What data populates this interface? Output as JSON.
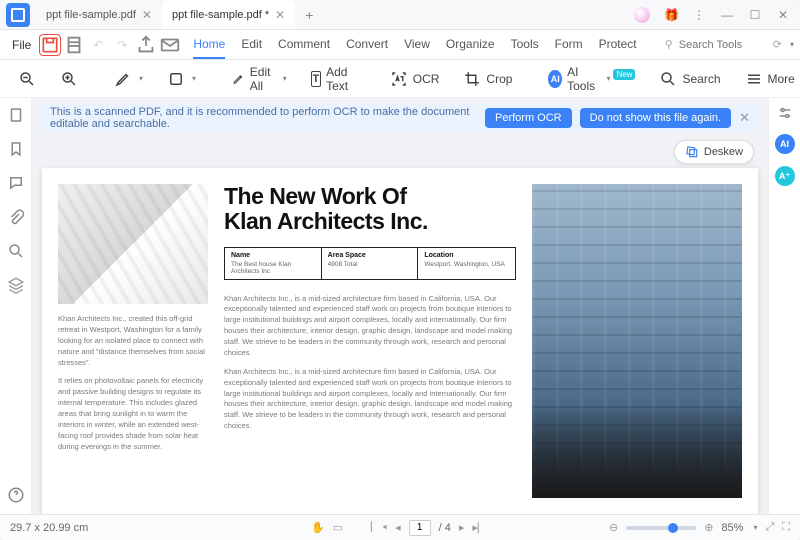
{
  "tabs": [
    {
      "label": "ppt file-sample.pdf"
    },
    {
      "label": "ppt file-sample.pdf *"
    }
  ],
  "menu": {
    "file": "File",
    "items": [
      "Home",
      "Edit",
      "Comment",
      "Convert",
      "View",
      "Organize",
      "Tools",
      "Form",
      "Protect"
    ],
    "search_placeholder": "Search Tools"
  },
  "toolbar": {
    "edit_all": "Edit All",
    "add_text": "Add Text",
    "ocr": "OCR",
    "crop": "Crop",
    "ai_tools": "AI Tools",
    "new": "New",
    "search": "Search",
    "more": "More"
  },
  "banner": {
    "msg": "This is a scanned PDF, and it is recommended to perform OCR to make the document editable and searchable.",
    "perform": "Perform OCR",
    "dismiss": "Do not show this file again."
  },
  "deskew": "Deskew",
  "doc": {
    "headline1": "The New Work Of",
    "headline2": "Klan Architects Inc.",
    "info": {
      "name_lbl": "Name",
      "name_val": "The Best house Klan Architects Inc",
      "area_lbl": "Area Space",
      "area_val": "4908 Total",
      "loc_lbl": "Location",
      "loc_val": "Westport, Washington, USA"
    },
    "left_p1": "Khan Architects Inc., created this off-grid retreat in Westport, Washington for a family looking for an isolated place to connect with nature and \"distance themselves from social stresses\".",
    "left_p2": "It relies on photovoltaic panels for electricity and passive building designs to regulate its internal temperature. This includes glazed areas that bring sunlight in to warm the interiors in winter, while an extended west-facing roof provides shade from solar heat during evenings in the summer.",
    "mid_p": "Khan Architects Inc., is a mid-sized architecture firm based in California, USA. Our exceptionally talented and experienced staff work on projects from boutique interiors to large institutional buildings and airport complexes, locally and internationally. Our firm houses their architecture, interior design, graphic design, landscape and model making staff. We strieve to be leaders in the community through work, research and personal choices."
  },
  "status": {
    "dims": "29.7 x 20.99 cm",
    "page": "1",
    "total": "/ 4",
    "zoom": "85%"
  }
}
